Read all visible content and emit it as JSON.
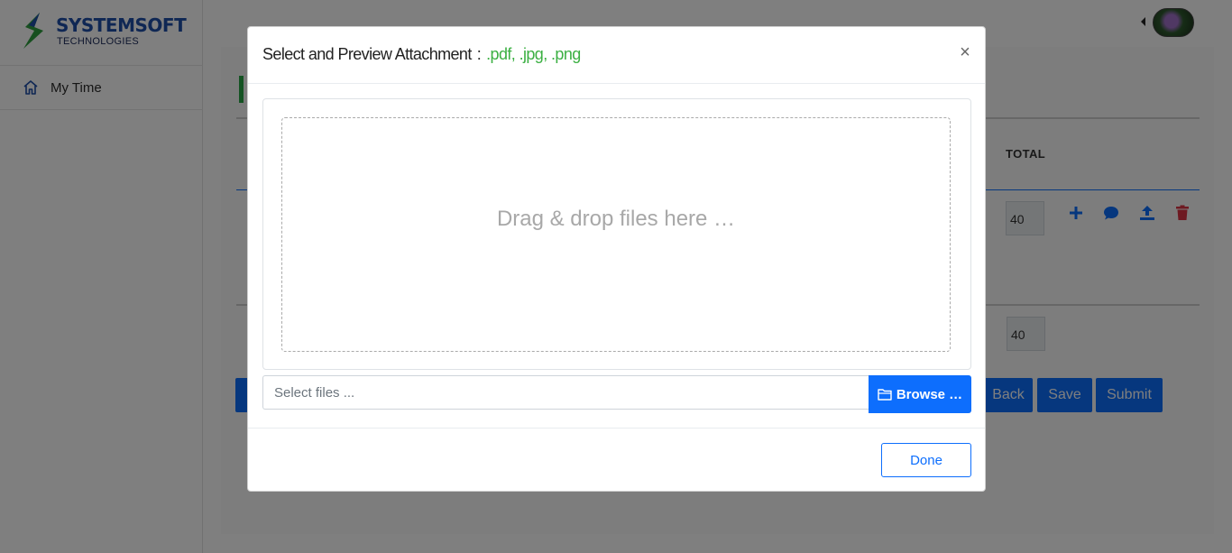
{
  "app": {
    "logo_main_a": "SYSTEM",
    "logo_main_b": "SOFT",
    "logo_sub": "TECHNOLOGIES",
    "brand_colors": {
      "logo_blue": "#1f4fa8",
      "logo_green": "#2e9e3e"
    }
  },
  "sidebar": {
    "items": [
      {
        "label": "My Time",
        "icon": "home-icon"
      }
    ]
  },
  "background_page": {
    "total_header": "TOTAL",
    "row_total": "40",
    "grand_total": "40",
    "row_actions": [
      "plus-icon",
      "comment-icon",
      "upload-icon",
      "trash-icon"
    ],
    "buttons": {
      "back": "Back",
      "save": "Save",
      "submit": "Submit"
    }
  },
  "modal": {
    "title": "Select and Preview Attachment",
    "separator": ":",
    "formats": ".pdf, .jpg, .png",
    "close_symbol": "×",
    "drop_text": "Drag & drop files here …",
    "file_placeholder": "Select files ...",
    "browse_label": "Browse …",
    "done_label": "Done",
    "colors": {
      "primary": "#0d6efd",
      "formats": "#3cb043"
    }
  }
}
